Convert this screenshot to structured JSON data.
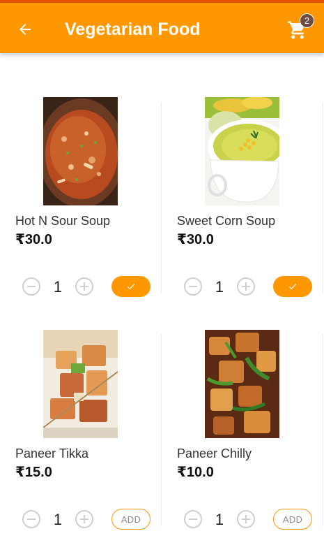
{
  "app_bar": {
    "title": "Vegetarian Food",
    "back_icon": "arrow-back-icon",
    "cart_icon": "shopping-cart-icon",
    "cart_count": "2",
    "background": "#FF9800",
    "title_color": "#FFFFFF"
  },
  "items": [
    {
      "name": "Hot N Sour Soup",
      "price": "₹30.0",
      "quantity": "1",
      "added": true,
      "action_label": ""
    },
    {
      "name": "Sweet Corn Soup",
      "price": "₹30.0",
      "quantity": "1",
      "added": true,
      "action_label": ""
    },
    {
      "name": "Paneer Tikka",
      "price": "₹15.0",
      "quantity": "1",
      "added": false,
      "action_label": "ADD"
    },
    {
      "name": "Paneer Chilly",
      "price": "₹10.0",
      "quantity": "1",
      "added": false,
      "action_label": "ADD"
    }
  ],
  "colors": {
    "accent": "#FF9800",
    "status_bar": "#E65100",
    "qty_button": "#CFCFCF"
  }
}
